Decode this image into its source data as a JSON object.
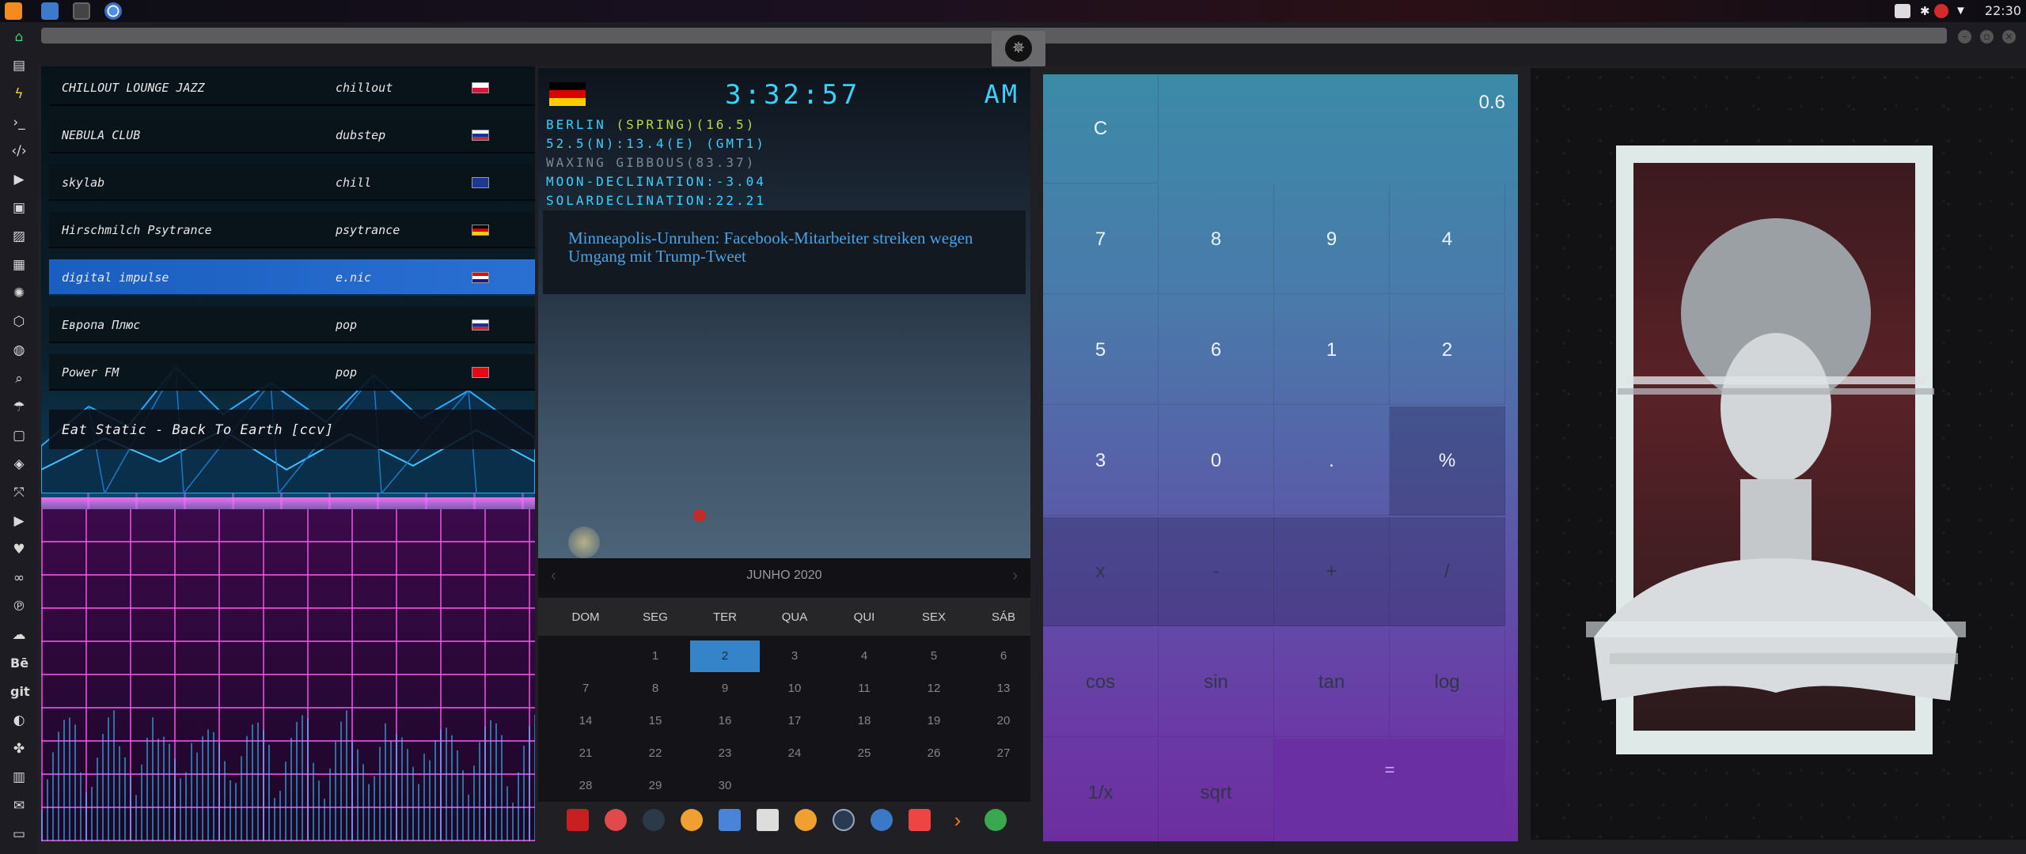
{
  "top_panel": {
    "time": "22:30",
    "app_icons": [
      "sublime-icon",
      "files-icon",
      "terminal-icon",
      "chromium-icon"
    ],
    "tray_icons": [
      "screenshot-icon",
      "bluetooth-icon",
      "settings-icon",
      "wifi-icon"
    ]
  },
  "dock": {
    "icons": [
      "home-icon",
      "document-icon",
      "bolt-icon",
      "terminal-icon",
      "code-icon",
      "play-icon",
      "clipboard-icon",
      "image-icon",
      "newspaper-icon",
      "aperture-icon",
      "hexagon-icon",
      "globe-icon",
      "search-icon",
      "umbrella-icon",
      "contact-icon",
      "tag-icon",
      "expand-icon",
      "youtube-icon",
      "heart-icon",
      "link-icon",
      "pinterest-icon",
      "cloud-icon",
      "behance-icon",
      "git-icon",
      "github-icon",
      "puzzle-icon",
      "map-icon",
      "mail-icon",
      "chat-icon"
    ],
    "behance_label": "Bē",
    "git_label": "git"
  },
  "radio": {
    "stations": [
      {
        "name": "CHILLOUT LOUNGE JAZZ",
        "genre": "chillout",
        "flag": "poland"
      },
      {
        "name": "NEBULA CLUB",
        "genre": "dubstep",
        "flag": "russia"
      },
      {
        "name": "skylab",
        "genre": "chill",
        "flag": "uk"
      },
      {
        "name": "Hirschmilch Psytrance",
        "genre": "psytrance",
        "flag": "germany"
      },
      {
        "name": "digital impulse",
        "genre": "e.nic",
        "flag": "croatia",
        "active": true
      },
      {
        "name": "Европа Плюс",
        "genre": "pop",
        "flag": "russia"
      },
      {
        "name": "Power FM",
        "genre": "pop",
        "flag": "turkey"
      }
    ],
    "now_playing": "Eat Static - Back To Earth [ccv]"
  },
  "clock": {
    "time": "3:32:57",
    "ampm": "AM",
    "flag": "germany",
    "location": "BERLIN",
    "season": "(SPRING)(16.5)",
    "coords": "52.5(N):13.4(E) (GMT1)",
    "moon_phase": "WAXING GIBBOUS(83.37)",
    "moon_declination": "MOON-DECLINATION:-3.04",
    "solar_declination": "SOLARDECLINATION:22.21",
    "news": "Minneapolis-Unruhen: Facebook-Mitarbeiter streiken wegen Umgang mit Trump-Tweet"
  },
  "calendar": {
    "month": "JUNHO 2020",
    "weekdays": [
      "DOM",
      "SEG",
      "TER",
      "QUA",
      "QUI",
      "SEX",
      "SÁB"
    ],
    "weeks": [
      [
        "",
        "1",
        "2",
        "3",
        "4",
        "5",
        "6"
      ],
      [
        "7",
        "8",
        "9",
        "10",
        "11",
        "12",
        "13"
      ],
      [
        "14",
        "15",
        "16",
        "17",
        "18",
        "19",
        "20"
      ],
      [
        "21",
        "22",
        "23",
        "24",
        "25",
        "26",
        "27"
      ],
      [
        "28",
        "29",
        "30",
        "",
        "",
        "",
        ""
      ]
    ],
    "today": "2"
  },
  "icon_bar": [
    "app-icon",
    "hourglass-icon",
    "globe-dark-icon",
    "photos-icon",
    "translate-icon",
    "calendar-app-icon",
    "search-circle-icon",
    "clock-icon",
    "web-icon",
    "calendar-icon",
    "arrow-icon",
    "yandex-icon"
  ],
  "calculator": {
    "display": "0.6",
    "clear": "C",
    "rows": [
      [
        "7",
        "8",
        "9",
        "4"
      ],
      [
        "5",
        "6",
        "1",
        "2"
      ],
      [
        "3",
        "0",
        ".",
        "%"
      ],
      [
        "x",
        "-",
        "+",
        "/"
      ],
      [
        "cos",
        "sin",
        "tan",
        "log"
      ]
    ],
    "last_row": [
      "1/x",
      "sqrt"
    ],
    "equals": "="
  },
  "colors": {
    "accent": "#3bd0ff",
    "active_station": "#2a6fd2",
    "calendar_today": "#3584c9"
  }
}
